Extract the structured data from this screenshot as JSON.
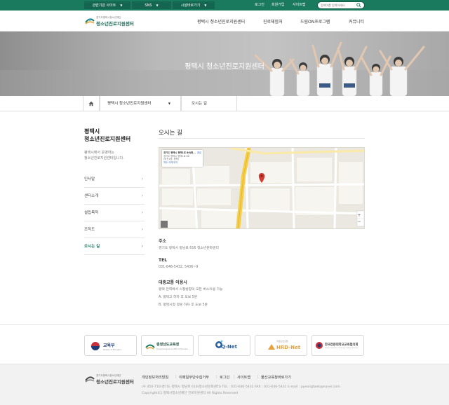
{
  "topbar": {
    "related_sites": "관련기관 사이트",
    "sns": "SNS",
    "facility_shortcut": "시설바로가기",
    "login": "로그인",
    "join": "회원가입",
    "sitemap": "사이트맵",
    "search_placeholder": "검색어를 입력하세요."
  },
  "header": {
    "logo_small": "경기도평택시청소년재단",
    "logo_main": "청소년진로지원센터",
    "nav": [
      "평택시 청소년진로지원센터",
      "진로체험처",
      "드림ON프로그램",
      "커뮤니티"
    ]
  },
  "hero": {
    "title": "평택시 청소년진로지원센터"
  },
  "location": {
    "home_icon": "home-icon",
    "section": "평택시 청소년진로지원센터",
    "current": "오시는 길"
  },
  "sidebar": {
    "title_line1": "평택시",
    "title_line2": "청소년진로지원센터",
    "desc_line1": "평택시에서 운영하는",
    "desc_line2": "청소년진로지원센터입니다.",
    "items": [
      {
        "label": "인사말"
      },
      {
        "label": "센터소개"
      },
      {
        "label": "설립목적"
      },
      {
        "label": "조직도"
      },
      {
        "label": "오시는 길"
      }
    ]
  },
  "content": {
    "title": "오시는 길",
    "map": {
      "popup_title": "경기도 평택시 평택1로 86(평...",
      "popup_sub1": "경기도 평택시 평택1로 86",
      "popup_sub2": "(비전1동, 평택)",
      "popup_link": "지도 크게 보기",
      "directions": "경로",
      "plus": "+",
      "minus": "−"
    },
    "address_label": "주소",
    "address": "경기도 평택시 평남로 616 청소년문화센터",
    "tel_label": "TEL",
    "tel": "031-646-5432, 5436~9",
    "transit_label": "대중교통 이용시",
    "transit_line1": "평택 전역에서 시청방향의 모든 버스이용 가능",
    "transit_line2": "A. 평택고 하차 후 도보 5분",
    "transit_line3": "B. 평택시청 정문 하차 후 도보 5분"
  },
  "partners": [
    {
      "name": "교육부",
      "sub": "Ministry of Education",
      "color": "#1f3b73"
    },
    {
      "name": "충청남도교육청",
      "sub": "Chungcheongnam-do Office of Education",
      "color": "#1f4c3c"
    },
    {
      "name": "Q-Net",
      "sub": "",
      "color": "#2a5fa0"
    },
    {
      "name": "HRD-Net",
      "sub": "직업훈련포털",
      "color": "#e9a23b"
    },
    {
      "name": "한국전문대학교교육협의회",
      "sub": "Korean Council for University College Education",
      "color": "#3a3a3a"
    }
  ],
  "footer": {
    "logo_small": "경기도평택시청소년재단",
    "logo_main": "청소년진로지원센터",
    "links": [
      "개인정보처리방침",
      "이메일무단수집거부",
      "로그인",
      "사이트맵",
      "울산교육청바로가기"
    ],
    "address": "(우 450-710)경기도 평택시 평남로 616(청소년문화센터)   TEL : 031-646-5432   FAX : 031-646-5431   E-mail : pyeongtaek@naver.com",
    "copyright": "Copyright(C) 평택시청소년재단 진로지원센터 All Rights Reserved"
  },
  "colors": {
    "brand_green": "#1a7a5e",
    "hero_gray": "#b4b4b4",
    "footer_bg": "#f2f2f2"
  }
}
